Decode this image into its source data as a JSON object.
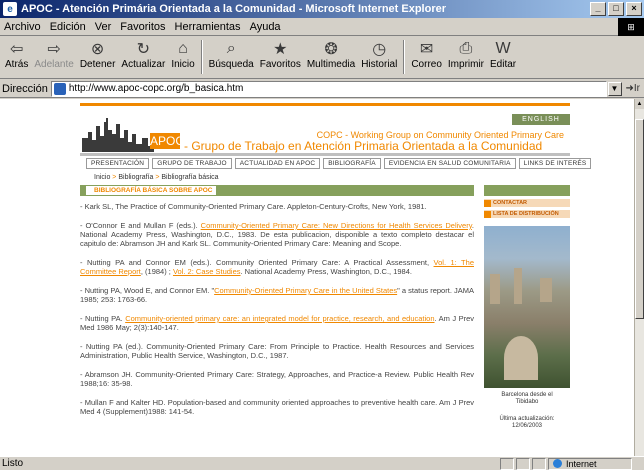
{
  "window": {
    "title": "APOC - Atención Primária Orientada a la Comunidad - Microsoft Internet Explorer",
    "app_icon": "e"
  },
  "menu": [
    "Archivo",
    "Edición",
    "Ver",
    "Favoritos",
    "Herramientas",
    "Ayuda"
  ],
  "toolbar": [
    {
      "label": "Atrás",
      "icon": "back-icon",
      "glyph": "⇦",
      "disabled": false
    },
    {
      "label": "Adelante",
      "icon": "forward-icon",
      "glyph": "⇨",
      "disabled": true
    },
    {
      "label": "Detener",
      "icon": "stop-icon",
      "glyph": "⊗",
      "disabled": false
    },
    {
      "label": "Actualizar",
      "icon": "refresh-icon",
      "glyph": "↻",
      "disabled": false
    },
    {
      "label": "Inicio",
      "icon": "home-icon",
      "glyph": "⌂",
      "disabled": false
    },
    {
      "label": "Búsqueda",
      "icon": "search-icon",
      "glyph": "⌕",
      "disabled": false
    },
    {
      "label": "Favoritos",
      "icon": "favorites-icon",
      "glyph": "★",
      "disabled": false
    },
    {
      "label": "Multimedia",
      "icon": "media-icon",
      "glyph": "❂",
      "disabled": false
    },
    {
      "label": "Historial",
      "icon": "history-icon",
      "glyph": "◷",
      "disabled": false
    },
    {
      "label": "Correo",
      "icon": "mail-icon",
      "glyph": "✉",
      "disabled": false
    },
    {
      "label": "Imprimir",
      "icon": "print-icon",
      "glyph": "⎙",
      "disabled": false
    },
    {
      "label": "Editar",
      "icon": "edit-icon",
      "glyph": "W",
      "disabled": false
    }
  ],
  "address": {
    "label": "Dirección",
    "url": "http://www.apoc-copc.org/b_basica.htm",
    "go": "Ir"
  },
  "site": {
    "english": "ENGLISH",
    "brand": "APOC",
    "wgoc": "COPC - Working Group on Community Oriented Primary Care",
    "grupo": "- Grupo de Trabajo en Atención Primaria Orientada a la Comunidad",
    "tabs": [
      "PRESENTACIÓN",
      "GRUPO DE TRABAJO",
      "ACTUALIDAD EN APOC",
      "BIBLIOGRAFÍA",
      "EVIDENCIA EN SALUD COMUNITARIA",
      "LINKS DE INTERÉS"
    ],
    "breadcrumb": [
      "Inicio",
      "Bibliografía",
      "Bibliografía básica"
    ],
    "section_title": "BIBLIOGRAFÍA BÁSICA SOBRE APOC",
    "entries": [
      {
        "pre": "- Kark SL, The Practice of Community-Oriented Primary Care. Appleton-Century-Crofts, New York, 1981.",
        "link": "",
        "post": ""
      },
      {
        "pre": "- O'Connor E and Mullan F (eds.). ",
        "link": "Community-Oriented Primary Care: New Directions for Health Services Delivery",
        "post": ". National Academy Press, Washington, D.C., 1983. De esta publicacion, disponible a texto completo destacar el capitulo de: Abramson JH and Kark SL. Community-Oriented Primary Care: Meaning and Scope."
      },
      {
        "pre": "- Nutting PA and Connor EM (eds.). Community Oriented Primary Care: A Practical Assessment, ",
        "link": "Vol. 1: The Committee Report",
        "post": ", (1984) ; ",
        "link2": "Vol. 2: Case Studies",
        "post2": ". National Academy Press, Washington, D.C., 1984."
      },
      {
        "pre": "- Nutting PA, Wood E, and Connor EM. \"",
        "link": "Community-Oriented Primary Care in the United States",
        "post": "\" a status report. JAMA 1985; 253: 1763-66."
      },
      {
        "pre": "- Nutting PA. ",
        "link": "Community-oriented primary care: an integrated model for practice, research, and education",
        "post": ". Am J Prev Med 1986 May; 2(3):140-147."
      },
      {
        "pre": "- Nutting PA (ed.). Community-Oriented Primary Care: From Principle to Practice. Health Resources and Services Administration, Public Health Service, Washington, D.C., 1987.",
        "link": "",
        "post": ""
      },
      {
        "pre": "- Abramson JH. Community-Oriented Primary Care: Strategy, Approaches, and Practice-a Review. Public Health Rev 1988;16: 35-98.",
        "link": "",
        "post": ""
      },
      {
        "pre": "- Mullan F and Kalter HD. Population-based and community oriented approaches to preventive health care. Am J Prev Med 4 (Supplement)1988: 141-54.",
        "link": "",
        "post": ""
      }
    ],
    "side_links": [
      "CONTACTAR",
      "LISTA DE DISTRIBUCIÓN"
    ],
    "photo_caption": [
      "Barcelona desde el",
      "Tibidabo"
    ],
    "updated": [
      "Última actualización:",
      "12/06/2003"
    ]
  },
  "status": {
    "text": "Listo",
    "zone": "Internet"
  }
}
